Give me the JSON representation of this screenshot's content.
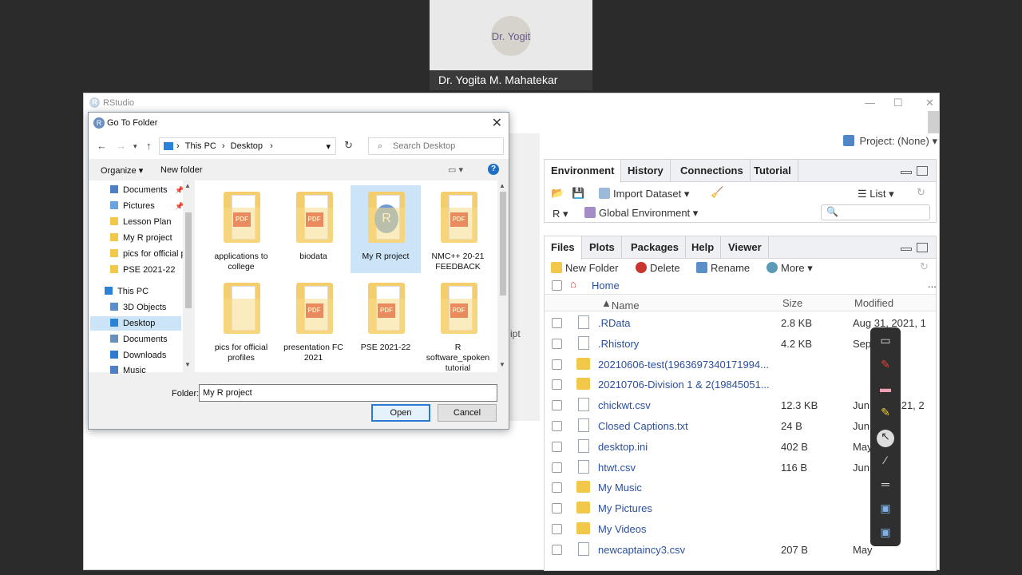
{
  "webcam": {
    "initials": "Dr. Yogit",
    "name": "Dr. Yogita M. Mahatekar"
  },
  "rstudio": {
    "title": "RStudio",
    "project": "Project: (None)",
    "env_pane": {
      "tabs": [
        "Environment",
        "History",
        "Connections",
        "Tutorial"
      ],
      "import_dataset": "Import Dataset",
      "list_label": "List",
      "r_label": "R",
      "global_env": "Global Environment"
    },
    "files_pane": {
      "tabs": [
        "Files",
        "Plots",
        "Packages",
        "Help",
        "Viewer"
      ],
      "new_folder": "New Folder",
      "delete": "Delete",
      "rename": "Rename",
      "more": "More",
      "home": "Home",
      "more_dots": "...",
      "col_name": "Name",
      "col_size": "Size",
      "col_modified": "Modified",
      "rows": [
        {
          "name": ".RData",
          "size": "2.8 KB",
          "modified": "Aug 31, 2021, 1",
          "type": "doc"
        },
        {
          "name": ".Rhistory",
          "size": "4.2 KB",
          "modified": "Sep",
          "type": "doc"
        },
        {
          "name": "20210606-test(1963697340171994...",
          "size": "",
          "modified": "",
          "type": "folder"
        },
        {
          "name": "20210706-Division 1 & 2(19845051...",
          "size": "",
          "modified": "",
          "type": "folder"
        },
        {
          "name": "chickwt.csv",
          "size": "12.3 KB",
          "modified": "Jun 10, 2021, 2",
          "type": "doc"
        },
        {
          "name": "Closed Captions.txt",
          "size": "24 B",
          "modified": "Jun",
          "type": "doc"
        },
        {
          "name": "desktop.ini",
          "size": "402 B",
          "modified": "May",
          "type": "doc"
        },
        {
          "name": "htwt.csv",
          "size": "116 B",
          "modified": "Jun",
          "type": "doc"
        },
        {
          "name": "My Music",
          "size": "",
          "modified": "",
          "type": "folder"
        },
        {
          "name": "My Pictures",
          "size": "",
          "modified": "",
          "type": "folder"
        },
        {
          "name": "My Videos",
          "size": "",
          "modified": "",
          "type": "folder"
        },
        {
          "name": "newcaptaincy3.csv",
          "size": "207 B",
          "modified": "May",
          "type": "doc"
        }
      ]
    },
    "left_fragment": "ipt"
  },
  "dialog": {
    "title": "Go To Folder",
    "path": [
      "This PC",
      "Desktop"
    ],
    "search_placeholder": "Search Desktop",
    "organize": "Organize",
    "new_folder": "New folder",
    "nav": [
      {
        "label": "Documents",
        "pinned": true
      },
      {
        "label": "Pictures",
        "pinned": true
      },
      {
        "label": "Lesson Plan",
        "pinned": false
      },
      {
        "label": "My R project",
        "pinned": false
      },
      {
        "label": "pics for official p",
        "pinned": false
      },
      {
        "label": "PSE 2021-22",
        "pinned": false
      },
      {
        "label": "This PC",
        "pinned": false
      },
      {
        "label": "3D Objects",
        "pinned": false
      },
      {
        "label": "Desktop",
        "pinned": false
      },
      {
        "label": "Documents",
        "pinned": false
      },
      {
        "label": "Downloads",
        "pinned": false
      },
      {
        "label": "Music",
        "pinned": false
      }
    ],
    "items": [
      {
        "label": "applications to college",
        "kind": "pdf"
      },
      {
        "label": "biodata",
        "kind": "pdf"
      },
      {
        "label": "My R project",
        "kind": "r"
      },
      {
        "label": "NMC++ 20-21 FEEDBACK",
        "kind": "pdf"
      },
      {
        "label": "pics for official profiles",
        "kind": "doc"
      },
      {
        "label": "presentation FC 2021",
        "kind": "pdf"
      },
      {
        "label": "PSE 2021-22",
        "kind": "pdf"
      },
      {
        "label": "R software_spoken tutorial",
        "kind": "pdf"
      }
    ],
    "folder_label": "Folder:",
    "folder_value": "My R project",
    "open": "Open",
    "cancel": "Cancel"
  },
  "icons": {
    "pdf_badge": "PDF",
    "r_badge": "R"
  },
  "colors": {
    "link": "#2b4fa0",
    "folder": "#f2c84b",
    "selection": "#cce4f7",
    "accent": "#2a7ad5"
  }
}
